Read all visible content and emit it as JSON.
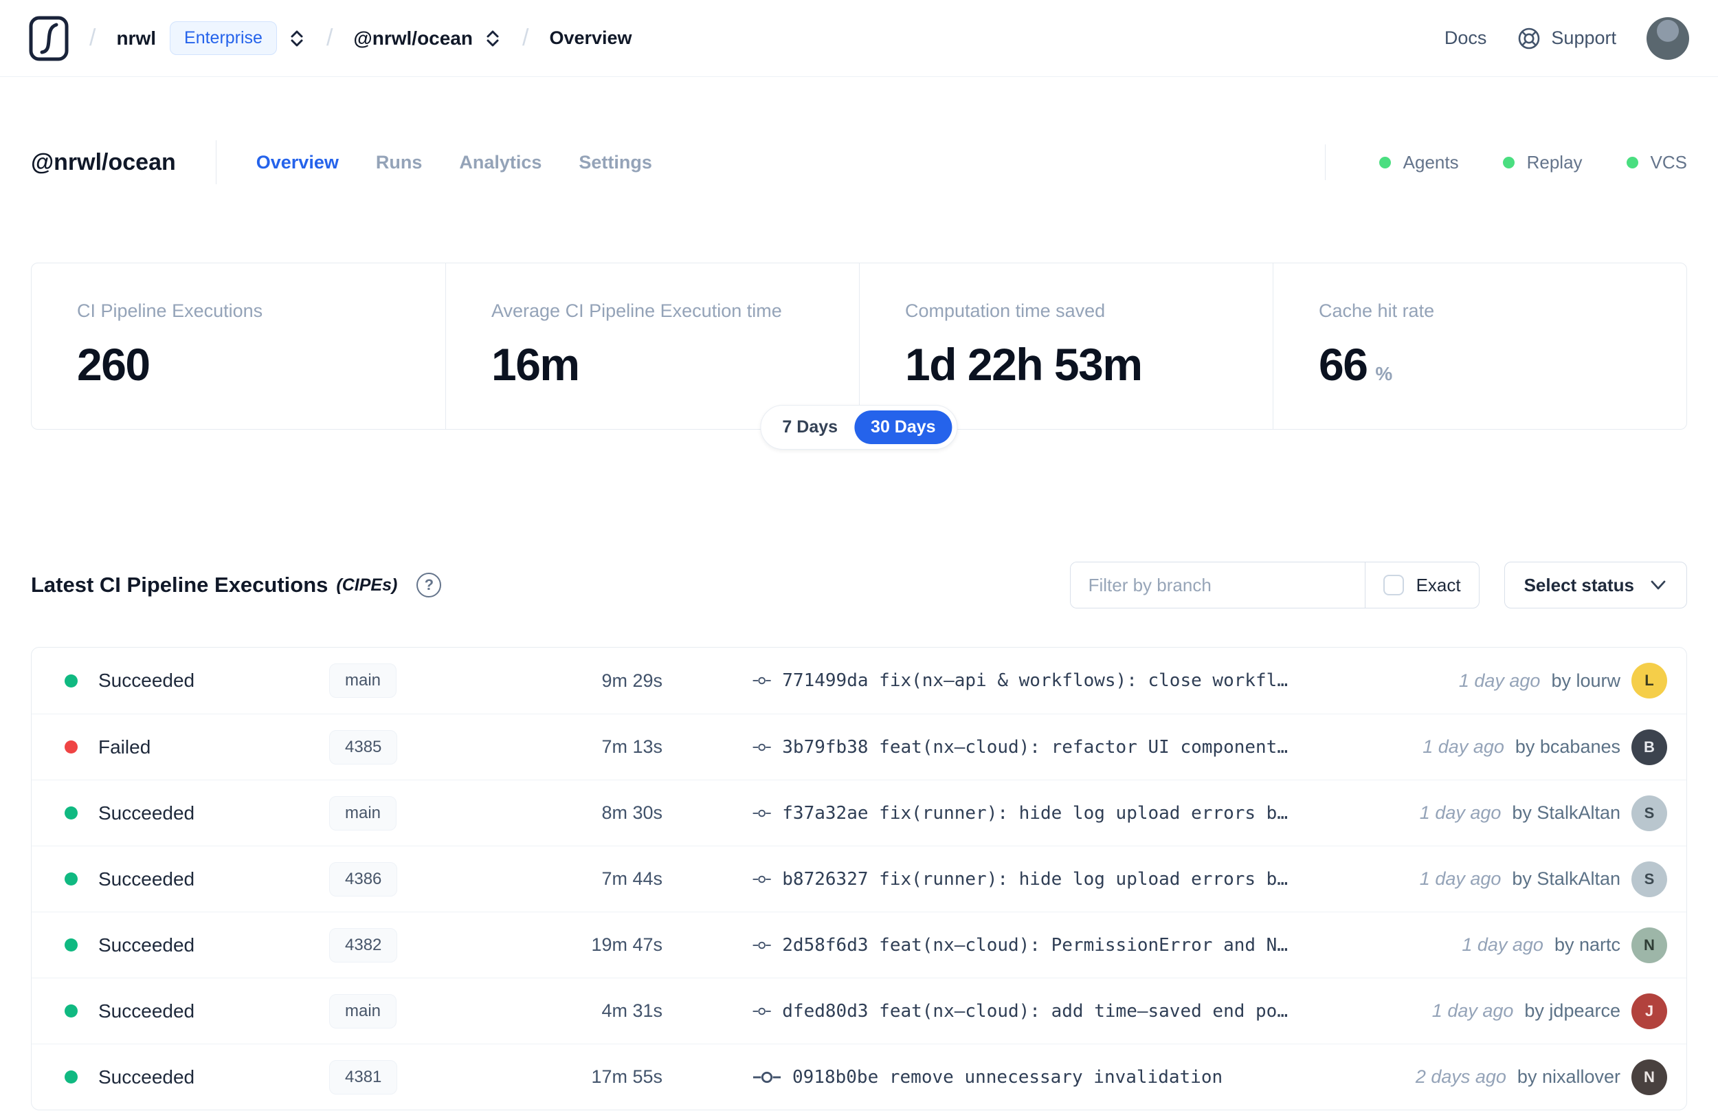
{
  "navbar": {
    "breadcrumb": {
      "org": "nrwl",
      "org_badge": "Enterprise",
      "workspace": "@nrwl/ocean",
      "page": "Overview"
    },
    "links": [
      {
        "label": "Docs"
      },
      {
        "label": "Support"
      }
    ]
  },
  "header": {
    "title": "@nrwl/ocean",
    "tabs": [
      {
        "label": "Overview",
        "active": true
      },
      {
        "label": "Runs",
        "active": false
      },
      {
        "label": "Analytics",
        "active": false
      },
      {
        "label": "Settings",
        "active": false
      }
    ],
    "statuses": [
      {
        "label": "Agents"
      },
      {
        "label": "Replay"
      },
      {
        "label": "VCS"
      }
    ]
  },
  "stats": {
    "cards": [
      {
        "label": "CI Pipeline Executions",
        "value": "260",
        "suffix": ""
      },
      {
        "label": "Average CI Pipeline Execution time",
        "value": "16m",
        "suffix": ""
      },
      {
        "label": "Computation time saved",
        "value": "1d 22h 53m",
        "suffix": ""
      },
      {
        "label": "Cache hit rate",
        "value": "66",
        "suffix": "%"
      }
    ],
    "range_toggle": {
      "options": [
        "7 Days",
        "30 Days"
      ],
      "selected": "30 Days"
    }
  },
  "cipes": {
    "title": "Latest CI Pipeline Executions",
    "title_suffix": "(CIPEs)",
    "filter": {
      "placeholder": "Filter by branch",
      "exact_label": "Exact"
    },
    "status_select_label": "Select status",
    "rows": [
      {
        "status": "Succeeded",
        "status_color": "#10b981",
        "branch": "main",
        "duration": "9m 29s",
        "commit": "771499da fix(nx–api & workflows): close workfl…",
        "time_ago": "1 day ago",
        "author": "by lourw",
        "avatar": {
          "bg": "#f5ce49",
          "fg": "#3b3b1f",
          "initial": "L"
        }
      },
      {
        "status": "Failed",
        "status_color": "#ef4444",
        "branch": "4385",
        "duration": "7m 13s",
        "commit": "3b79fb38 feat(nx–cloud): refactor UI component…",
        "time_ago": "1 day ago",
        "author": "by bcabanes",
        "avatar": {
          "bg": "#3c434e",
          "fg": "#e8eaee",
          "initial": "B"
        }
      },
      {
        "status": "Succeeded",
        "status_color": "#10b981",
        "branch": "main",
        "duration": "8m 30s",
        "commit": "f37a32ae fix(runner): hide log upload errors b…",
        "time_ago": "1 day ago",
        "author": "by StalkAltan",
        "avatar": {
          "bg": "#b9c6ce",
          "fg": "#3d4a52",
          "initial": "S"
        }
      },
      {
        "status": "Succeeded",
        "status_color": "#10b981",
        "branch": "4386",
        "duration": "7m 44s",
        "commit": "b8726327 fix(runner): hide log upload errors b…",
        "time_ago": "1 day ago",
        "author": "by StalkAltan",
        "avatar": {
          "bg": "#b9c6ce",
          "fg": "#3d4a52",
          "initial": "S"
        }
      },
      {
        "status": "Succeeded",
        "status_color": "#10b981",
        "branch": "4382",
        "duration": "19m 47s",
        "commit": "2d58f6d3 feat(nx–cloud): PermissionError and N…",
        "time_ago": "1 day ago",
        "author": "by nartc",
        "avatar": {
          "bg": "#9db6a8",
          "fg": "#2f3d35",
          "initial": "N"
        }
      },
      {
        "status": "Succeeded",
        "status_color": "#10b981",
        "branch": "main",
        "duration": "4m 31s",
        "commit": "dfed80d3 feat(nx–cloud): add time–saved end po…",
        "time_ago": "1 day ago",
        "author": "by jdpearce",
        "avatar": {
          "bg": "#b2423d",
          "fg": "#fbe9e8",
          "initial": "J"
        }
      },
      {
        "status": "Succeeded",
        "status_color": "#10b981",
        "branch": "4381",
        "duration": "17m 55s",
        "commit": "0918b0be remove unnecessary invalidation",
        "time_ago": "2 days ago",
        "author": "by nixallover",
        "avatar": {
          "bg": "#49413f",
          "fg": "#ece7e5",
          "initial": "N"
        }
      }
    ]
  },
  "colors": {
    "accent": "#2563eb",
    "succeeded": "#10b981",
    "failed": "#ef4444",
    "feature_dot": "#4ade80",
    "muted_text": "#94a3b8",
    "border": "#e6ebf1"
  }
}
